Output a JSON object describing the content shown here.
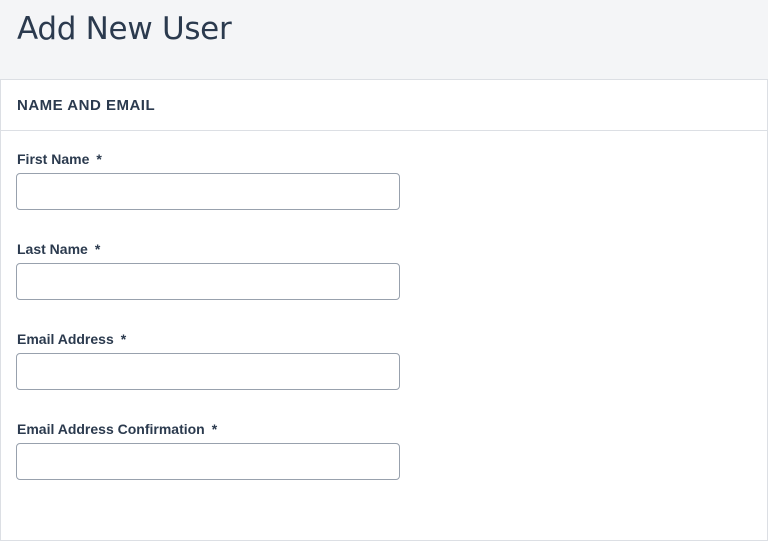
{
  "page": {
    "title": "Add New User"
  },
  "section": {
    "title": "NAME AND EMAIL"
  },
  "fields": {
    "first_name": {
      "label": "First Name",
      "required": "*",
      "value": "",
      "placeholder": ""
    },
    "last_name": {
      "label": "Last Name",
      "required": "*",
      "value": "",
      "placeholder": ""
    },
    "email": {
      "label": "Email Address",
      "required": "*",
      "value": "",
      "placeholder": ""
    },
    "email_confirm": {
      "label": "Email Address Confirmation",
      "required": "*",
      "value": "",
      "placeholder": ""
    }
  }
}
